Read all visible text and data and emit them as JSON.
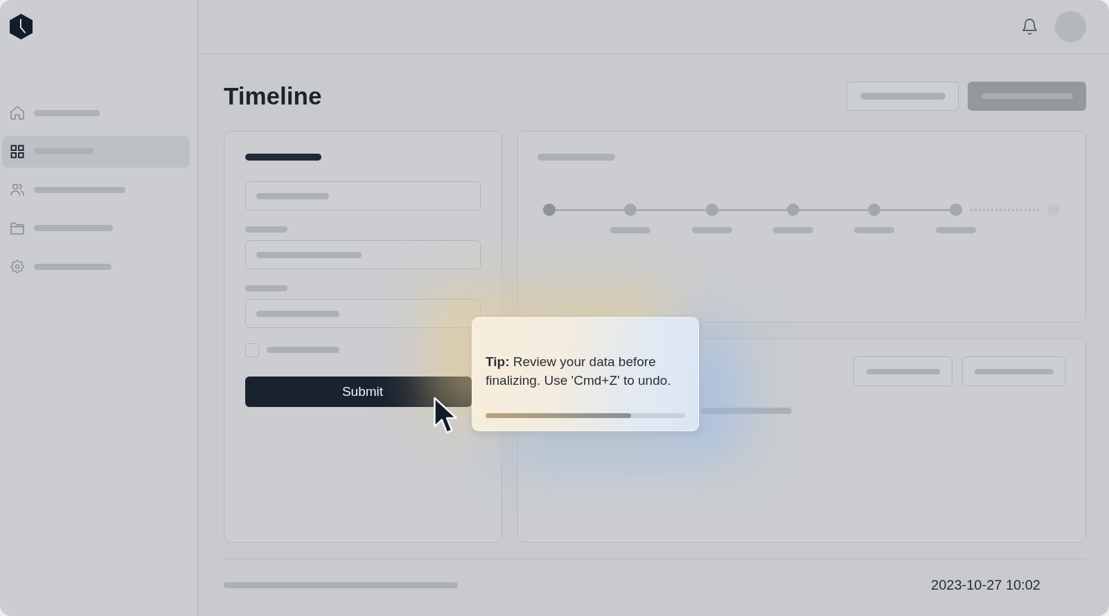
{
  "sidebar": {
    "items": [
      {
        "selected": false
      },
      {
        "selected": true
      },
      {
        "selected": false
      },
      {
        "selected": false
      },
      {
        "selected": false
      }
    ]
  },
  "page": {
    "title": "Timeline"
  },
  "form": {
    "checkbox": {
      "checked": false
    },
    "submit_button": {
      "label": "Submit"
    }
  },
  "timeline": {
    "steps": [
      {
        "active": true,
        "done": false
      },
      {
        "active": false,
        "done": true
      },
      {
        "active": false,
        "done": true
      },
      {
        "active": false,
        "done": true
      },
      {
        "active": false,
        "done": true
      },
      {
        "active": false,
        "done": true
      },
      {
        "active": false,
        "done": false
      }
    ]
  },
  "tooltip": {
    "text": "**Tip:** Review your data before finalizing. Use 'Cmd+Z' to undo.",
    "level": 0.73
  },
  "footer": {
    "timestamp": "2023-10-27 10:02"
  }
}
